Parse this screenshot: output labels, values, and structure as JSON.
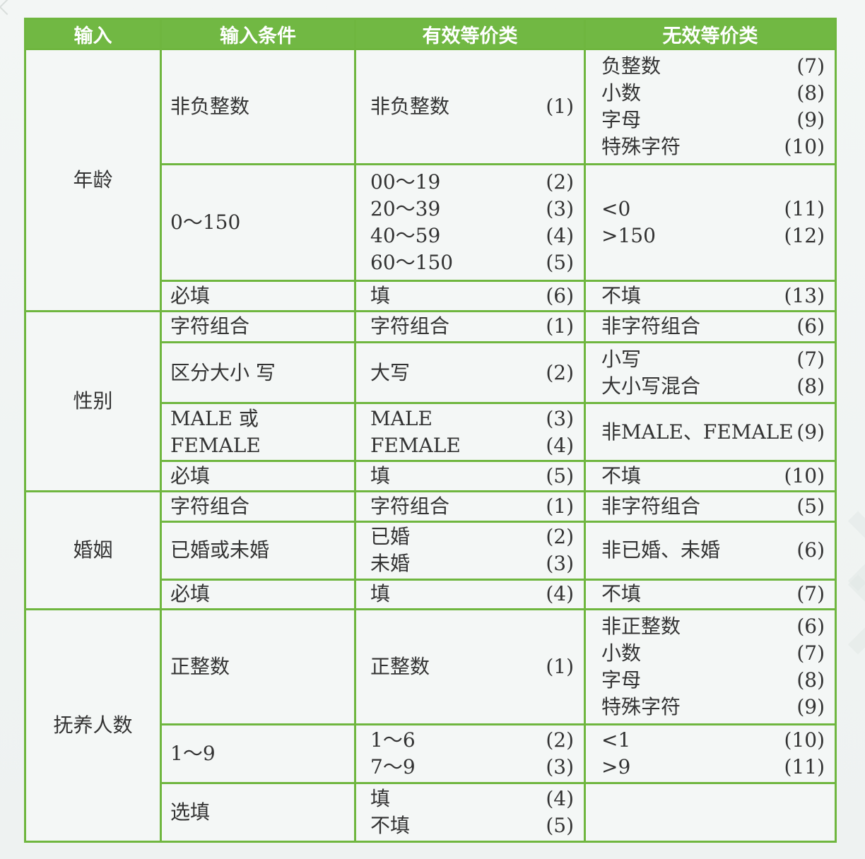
{
  "headers": [
    "输入",
    "输入条件",
    "有效等价类",
    "无效等价类"
  ],
  "groups": [
    {
      "input": "年龄",
      "rows": [
        {
          "condition": "非负整数",
          "valid": [
            {
              "text": "非负整数",
              "num": "(1)"
            }
          ],
          "invalid": [
            {
              "text": "负整数",
              "num": "(7)"
            },
            {
              "text": "小数",
              "num": "(8)"
            },
            {
              "text": "字母",
              "num": "(9)"
            },
            {
              "text": "特殊字符",
              "num": "(10)"
            }
          ]
        },
        {
          "condition": "0～150",
          "valid": [
            {
              "text": "00～19",
              "num": "(2)"
            },
            {
              "text": "20～39",
              "num": "(3)"
            },
            {
              "text": "40～59",
              "num": "(4)"
            },
            {
              "text": "60～150",
              "num": "(5)"
            }
          ],
          "invalid": [
            {
              "text": "<0",
              "num": "(11)"
            },
            {
              "text": ">150",
              "num": "(12)"
            }
          ]
        },
        {
          "condition": "必填",
          "valid": [
            {
              "text": "填",
              "num": "(6)"
            }
          ],
          "invalid": [
            {
              "text": "不填",
              "num": "(13)"
            }
          ]
        }
      ]
    },
    {
      "input": "性别",
      "rows": [
        {
          "condition": "字符组合",
          "valid": [
            {
              "text": "字符组合",
              "num": "(1)"
            }
          ],
          "invalid": [
            {
              "text": "非字符组合",
              "num": "(6)"
            }
          ]
        },
        {
          "condition": "区分大小 写",
          "valid": [
            {
              "text": "大写",
              "num": "(2)"
            }
          ],
          "invalid": [
            {
              "text": "小写",
              "num": "(7)"
            },
            {
              "text": "大小写混合",
              "num": "(8)"
            }
          ]
        },
        {
          "condition": "MALE 或 FEMALE",
          "valid": [
            {
              "text": "MALE",
              "num": "(3)"
            },
            {
              "text": "FEMALE",
              "num": "(4)"
            }
          ],
          "invalid": [
            {
              "text": "非MALE、FEMALE",
              "num": "(9)"
            }
          ]
        },
        {
          "condition": "必填",
          "valid": [
            {
              "text": "填",
              "num": "(5)"
            }
          ],
          "invalid": [
            {
              "text": "不填",
              "num": "(10)"
            }
          ]
        }
      ]
    },
    {
      "input": "婚姻",
      "rows": [
        {
          "condition": "字符组合",
          "valid": [
            {
              "text": "字符组合",
              "num": "(1)"
            }
          ],
          "invalid": [
            {
              "text": "非字符组合",
              "num": "(5)"
            }
          ]
        },
        {
          "condition": "已婚或未婚",
          "valid": [
            {
              "text": "已婚",
              "num": "(2)"
            },
            {
              "text": "未婚",
              "num": "(3)"
            }
          ],
          "invalid": [
            {
              "text": "非已婚、未婚",
              "num": "(6)"
            }
          ]
        },
        {
          "condition": "必填",
          "valid": [
            {
              "text": "填",
              "num": "(4)"
            }
          ],
          "invalid": [
            {
              "text": "不填",
              "num": "(7)"
            }
          ]
        }
      ]
    },
    {
      "input": "抚养人数",
      "rows": [
        {
          "condition": "正整数",
          "valid": [
            {
              "text": "正整数",
              "num": "(1)"
            }
          ],
          "invalid": [
            {
              "text": "非正整数",
              "num": "(6)"
            },
            {
              "text": "小数",
              "num": "(7)"
            },
            {
              "text": "字母",
              "num": "(8)"
            },
            {
              "text": "特殊字符",
              "num": "(9)"
            }
          ]
        },
        {
          "condition": "1～9",
          "valid": [
            {
              "text": "1～6",
              "num": "(2)"
            },
            {
              "text": "7～9",
              "num": "(3)"
            }
          ],
          "invalid": [
            {
              "text": "<1",
              "num": "(10)"
            },
            {
              "text": ">9",
              "num": "(11)"
            }
          ]
        },
        {
          "condition": "选填",
          "valid": [
            {
              "text": "填",
              "num": "(4)"
            },
            {
              "text": "不填",
              "num": "(5)"
            }
          ],
          "invalid": []
        }
      ]
    }
  ],
  "colors": {
    "header_bg": "#71b843",
    "border": "#6fb63f",
    "header_text": "#ffffff",
    "body_text": "#333333"
  }
}
